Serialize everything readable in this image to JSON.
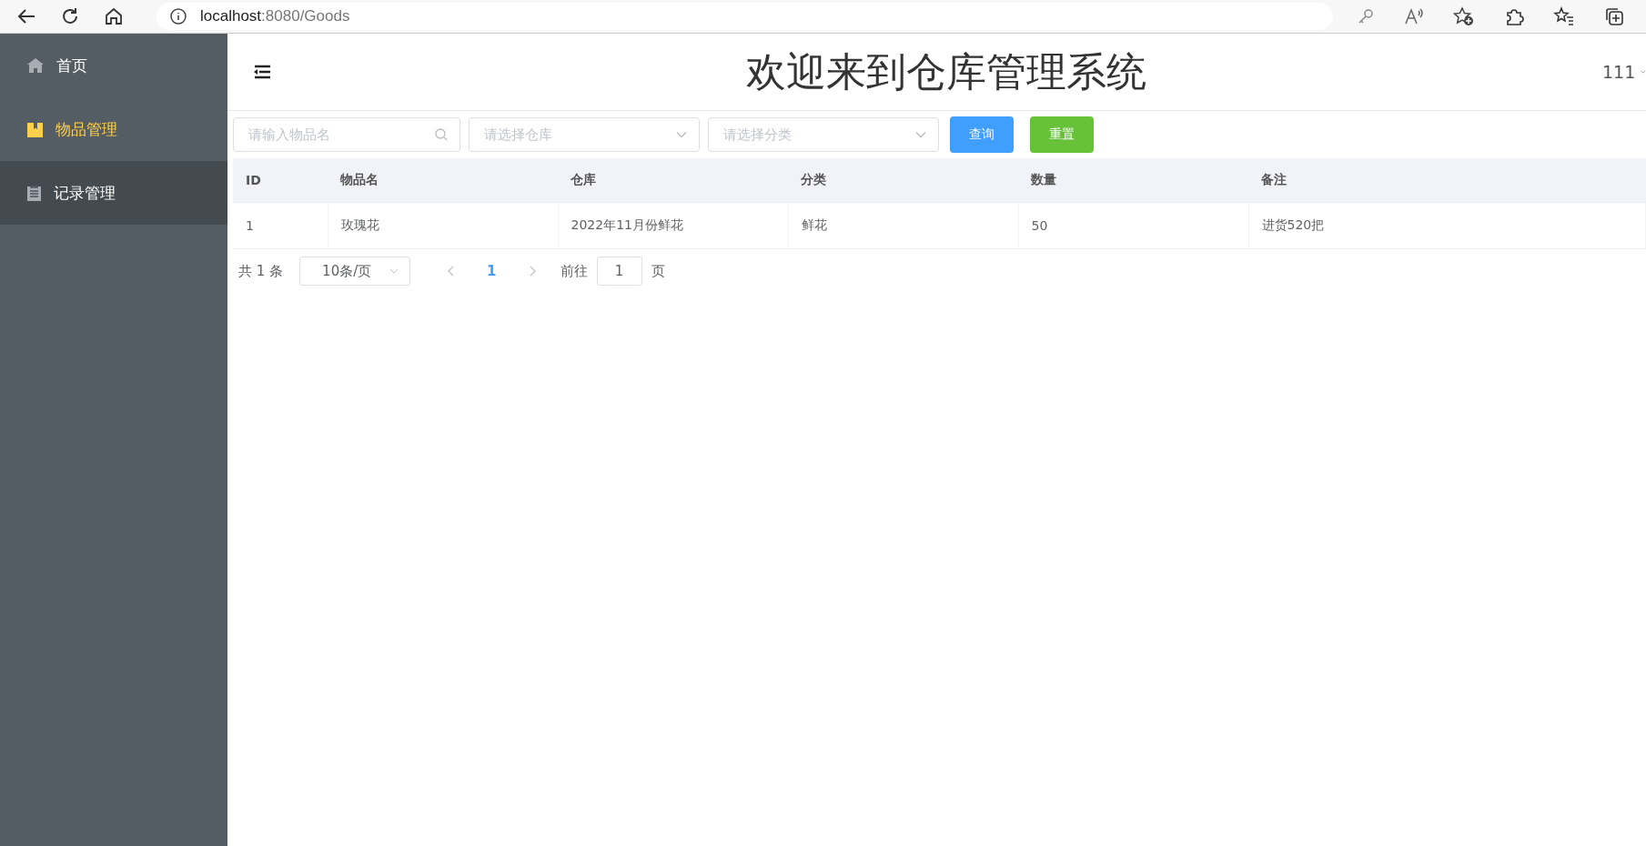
{
  "browser": {
    "url_host": "localhost",
    "url_rest": ":8080/Goods"
  },
  "sidebar": {
    "items": [
      {
        "label": "首页",
        "kind": "home",
        "selected": false,
        "highlighted": false
      },
      {
        "label": "物品管理",
        "kind": "goods",
        "selected": true,
        "highlighted": false
      },
      {
        "label": "记录管理",
        "kind": "records",
        "selected": false,
        "highlighted": true
      }
    ]
  },
  "header": {
    "title": "欢迎来到仓库管理系统",
    "user": "111"
  },
  "filters": {
    "name": {
      "placeholder": "请输入物品名"
    },
    "storage": {
      "placeholder": "请选择仓库"
    },
    "category": {
      "placeholder": "请选择分类"
    },
    "buttons": [
      {
        "label": "查询",
        "kind": "primary"
      },
      {
        "label": "重置",
        "kind": "success"
      }
    ]
  },
  "table": {
    "columns": [
      "ID",
      "物品名",
      "仓库",
      "分类",
      "数量",
      "备注"
    ],
    "rows": [
      [
        "1",
        "玫瑰花",
        "2022年11月份鲜花",
        "鲜花",
        "50",
        "进货520把"
      ]
    ]
  },
  "pagination": {
    "total": "共 1 条",
    "page_size": "10条/页",
    "pages": [
      {
        "label": "1",
        "selected": true
      }
    ],
    "goto_label": "前往",
    "goto_value": "1",
    "goto_suffix": "页"
  }
}
